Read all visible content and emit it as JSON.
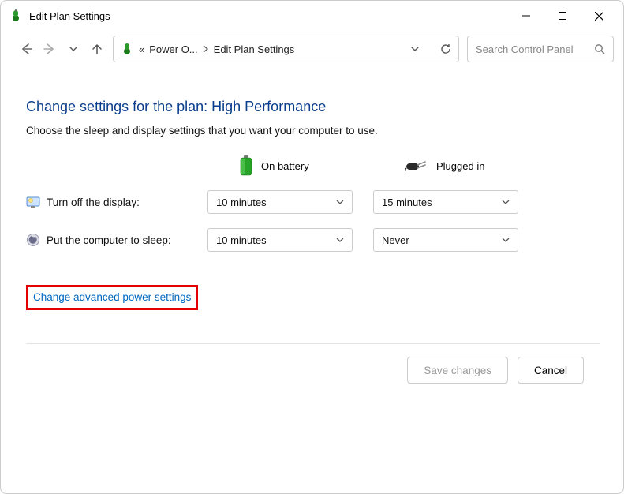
{
  "window": {
    "title": "Edit Plan Settings"
  },
  "breadcrumb": {
    "level1": "Power O...",
    "level2": "Edit Plan Settings"
  },
  "search": {
    "placeholder": "Search Control Panel"
  },
  "main": {
    "heading": "Change settings for the plan: High Performance",
    "subheading": "Choose the sleep and display settings that you want your computer to use.",
    "columns": {
      "battery": "On battery",
      "plugged": "Plugged in"
    },
    "rows": {
      "display": {
        "label": "Turn off the display:",
        "battery_value": "10 minutes",
        "plugged_value": "15 minutes"
      },
      "sleep": {
        "label": "Put the computer to sleep:",
        "battery_value": "10 minutes",
        "plugged_value": "Never"
      }
    },
    "advanced_link": "Change advanced power settings"
  },
  "buttons": {
    "save": "Save changes",
    "cancel": "Cancel"
  }
}
